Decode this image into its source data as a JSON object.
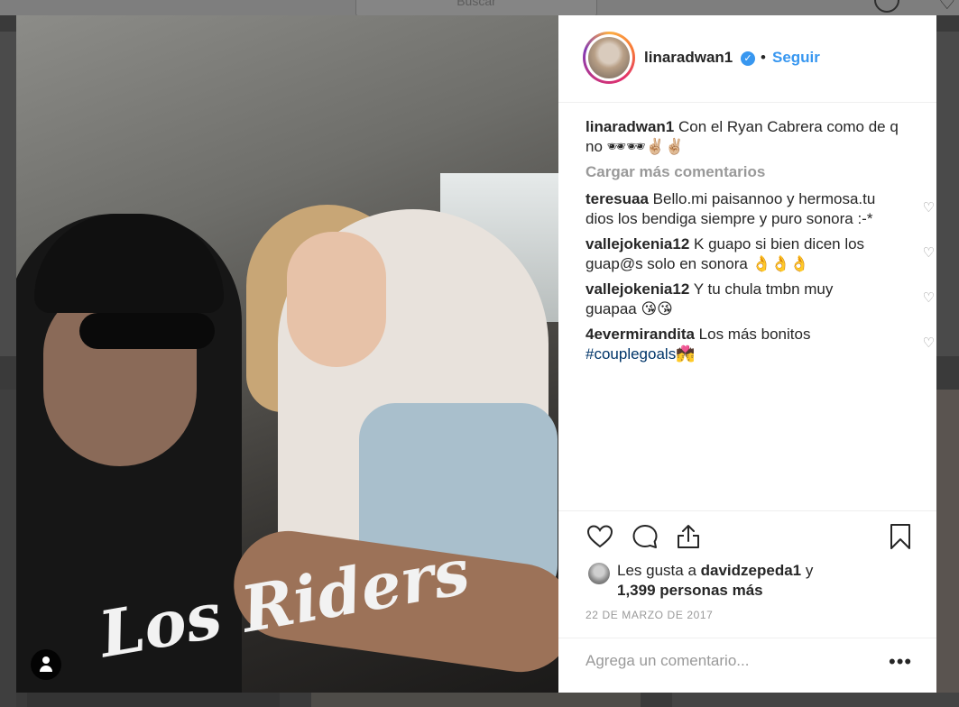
{
  "topbar": {
    "search_placeholder": "Buscar"
  },
  "post": {
    "username": "linaradwan1",
    "verified": true,
    "separator": "•",
    "follow_label": "Seguir",
    "caption_user": "linaradwan1",
    "caption_text": " Con el Ryan Cabrera como de q no 🕶🕶✌🏼✌🏼",
    "load_more_label": "Cargar más comentarios",
    "comments": [
      {
        "user": "teresuaa",
        "text": " Bello.mi paisannoo y hermosa.tu dios los bendiga siempre y puro sonora :-*"
      },
      {
        "user": "vallejokenia12",
        "text": " K guapo si bien dicen los guap@s solo en sonora 👌👌👌"
      },
      {
        "user": "vallejokenia12",
        "text": " Y tu chula tmbn muy guapaa 😘😘"
      },
      {
        "user": "4evermirandita",
        "text": " Los más bonitos ",
        "hashtag": "#couplegoals💏"
      }
    ],
    "likes_prefix": "Les gusta a ",
    "likes_user": "davidzepeda1",
    "likes_middle": " y",
    "likes_count": "1,399 personas más",
    "date": "22 DE MARZO DE 2017",
    "add_comment_placeholder": "Agrega un comentario...",
    "more_options_label": "•••"
  },
  "photo": {
    "shirt_text": "Los Riders"
  },
  "icons": {
    "verified": "verified-badge-icon",
    "like": "heart-icon",
    "comment": "comment-bubble-icon",
    "share": "share-icon",
    "save": "bookmark-icon",
    "comment_like": "small-heart-icon",
    "user_tag": "user-tag-icon",
    "verified_glyph": "✓",
    "heart_glyph": "♡"
  },
  "colors": {
    "link_blue": "#3897f0",
    "hashtag": "#003569",
    "muted": "#999999",
    "text": "#262626",
    "overlay": "#3a3a3a"
  }
}
